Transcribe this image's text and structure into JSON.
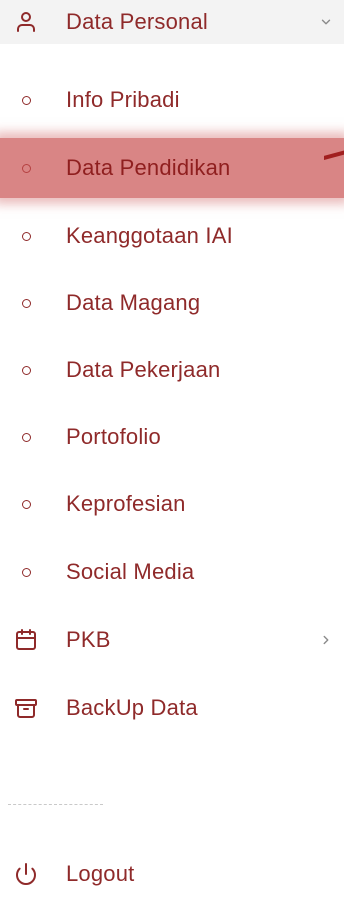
{
  "menu": {
    "header": {
      "label": "Data Personal",
      "icon": "user-icon",
      "chevron": "chevron-down-icon"
    },
    "items": [
      {
        "label": "Info Pribadi",
        "icon": "circle-icon"
      },
      {
        "label": "Data Pendidikan",
        "icon": "circle-icon",
        "active": true
      },
      {
        "label": "Keanggotaan IAI",
        "icon": "circle-icon"
      },
      {
        "label": "Data Magang",
        "icon": "circle-icon"
      },
      {
        "label": "Data Pekerjaan",
        "icon": "circle-icon"
      },
      {
        "label": "Portofolio",
        "icon": "circle-icon"
      },
      {
        "label": "Keprofesian",
        "icon": "circle-icon"
      },
      {
        "label": "Social Media",
        "icon": "circle-icon"
      }
    ],
    "pkb": {
      "label": "PKB",
      "icon": "calendar-icon",
      "chevron": "chevron-right-icon"
    },
    "backup": {
      "label": "BackUp Data",
      "icon": "archive-icon"
    },
    "logout": {
      "label": "Logout",
      "icon": "power-icon"
    }
  },
  "colors": {
    "primary": "#8f2a2a",
    "active_bg": "#d98585",
    "header_bg": "#f3f3f3"
  }
}
